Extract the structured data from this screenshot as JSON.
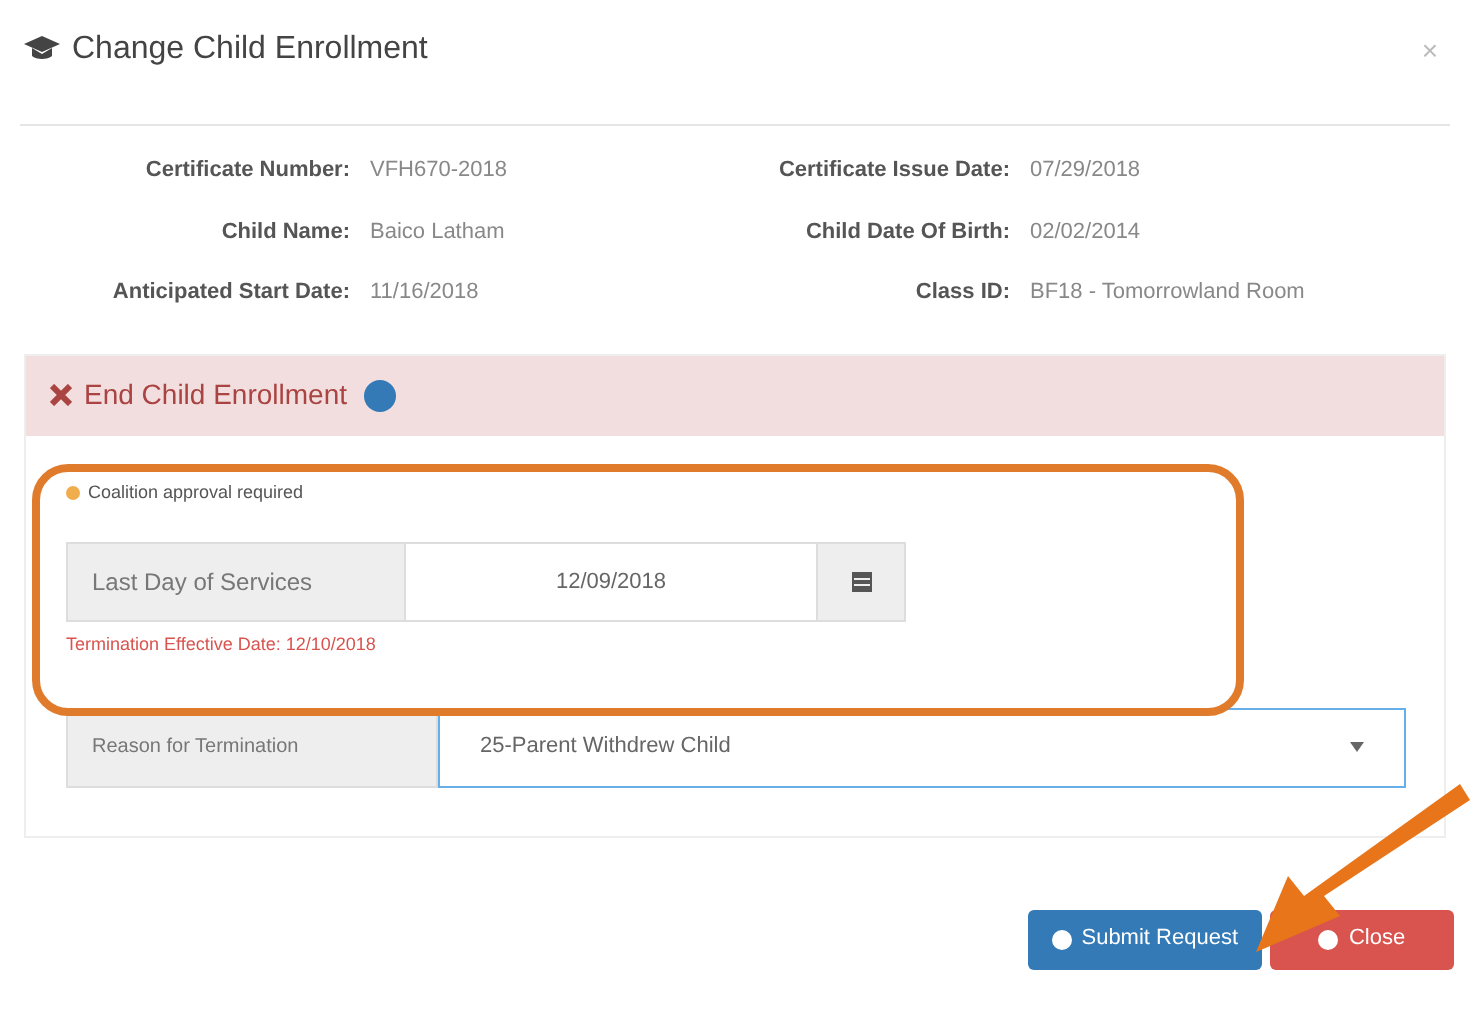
{
  "dialog": {
    "title": "Change Child Enrollment",
    "close": "×"
  },
  "details": [
    {
      "label": "Certificate Number:",
      "value": "VFH670-2018"
    },
    {
      "label": "Certificate Issue Date:",
      "value": "07/29/2018"
    },
    {
      "label": "Child Name:",
      "value": "Baico Latham"
    },
    {
      "label": "Child Date Of Birth:",
      "value": "02/02/2014"
    },
    {
      "label": "Anticipated Start Date:",
      "value": "11/16/2018"
    },
    {
      "label": "Class ID:",
      "value": "BF18 - Tomorrowland Room"
    }
  ],
  "panel": {
    "title": "End Child Enrollment",
    "notice": "Coalition approval required",
    "last_day": {
      "label": "Last Day of Services",
      "value": "12/09/2018"
    },
    "effective": "Termination Effective Date: 12/10/2018",
    "reason": {
      "label": "Reason for Termination",
      "value": "25-Parent Withdrew Child"
    }
  },
  "buttons": [
    {
      "label": "Submit Request",
      "kind": "primary"
    },
    {
      "label": "Close",
      "kind": "danger"
    }
  ]
}
